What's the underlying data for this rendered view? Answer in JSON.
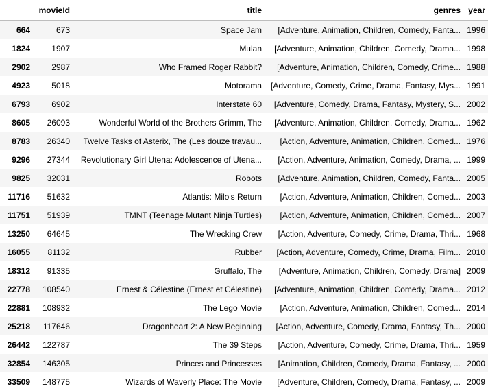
{
  "table": {
    "columns": [
      "",
      "movieId",
      "title",
      "genres",
      "year"
    ],
    "rows": [
      {
        "index": "664",
        "movieId": "673",
        "title": "Space Jam",
        "genres": "[Adventure, Animation, Children, Comedy, Fanta...",
        "year": "1996"
      },
      {
        "index": "1824",
        "movieId": "1907",
        "title": "Mulan",
        "genres": "[Adventure, Animation, Children, Comedy, Drama...",
        "year": "1998"
      },
      {
        "index": "2902",
        "movieId": "2987",
        "title": "Who Framed Roger Rabbit?",
        "genres": "[Adventure, Animation, Children, Comedy, Crime...",
        "year": "1988"
      },
      {
        "index": "4923",
        "movieId": "5018",
        "title": "Motorama",
        "genres": "[Adventure, Comedy, Crime, Drama, Fantasy, Mys...",
        "year": "1991"
      },
      {
        "index": "6793",
        "movieId": "6902",
        "title": "Interstate 60",
        "genres": "[Adventure, Comedy, Drama, Fantasy, Mystery, S...",
        "year": "2002"
      },
      {
        "index": "8605",
        "movieId": "26093",
        "title": "Wonderful World of the Brothers Grimm, The",
        "genres": "[Adventure, Animation, Children, Comedy, Drama...",
        "year": "1962"
      },
      {
        "index": "8783",
        "movieId": "26340",
        "title": "Twelve Tasks of Asterix, The (Les douze travau...",
        "genres": "[Action, Adventure, Animation, Children, Comed...",
        "year": "1976"
      },
      {
        "index": "9296",
        "movieId": "27344",
        "title": "Revolutionary Girl Utena: Adolescence of Utena...",
        "genres": "[Action, Adventure, Animation, Comedy, Drama, ...",
        "year": "1999"
      },
      {
        "index": "9825",
        "movieId": "32031",
        "title": "Robots",
        "genres": "[Adventure, Animation, Children, Comedy, Fanta...",
        "year": "2005"
      },
      {
        "index": "11716",
        "movieId": "51632",
        "title": "Atlantis: Milo's Return",
        "genres": "[Action, Adventure, Animation, Children, Comed...",
        "year": "2003"
      },
      {
        "index": "11751",
        "movieId": "51939",
        "title": "TMNT (Teenage Mutant Ninja Turtles)",
        "genres": "[Action, Adventure, Animation, Children, Comed...",
        "year": "2007"
      },
      {
        "index": "13250",
        "movieId": "64645",
        "title": "The Wrecking Crew",
        "genres": "[Action, Adventure, Comedy, Crime, Drama, Thri...",
        "year": "1968"
      },
      {
        "index": "16055",
        "movieId": "81132",
        "title": "Rubber",
        "genres": "[Action, Adventure, Comedy, Crime, Drama, Film...",
        "year": "2010"
      },
      {
        "index": "18312",
        "movieId": "91335",
        "title": "Gruffalo, The",
        "genres": "[Adventure, Animation, Children, Comedy, Drama]",
        "year": "2009"
      },
      {
        "index": "22778",
        "movieId": "108540",
        "title": "Ernest & Célestine (Ernest et Célestine)",
        "genres": "[Adventure, Animation, Children, Comedy, Drama...",
        "year": "2012"
      },
      {
        "index": "22881",
        "movieId": "108932",
        "title": "The Lego Movie",
        "genres": "[Action, Adventure, Animation, Children, Comed...",
        "year": "2014"
      },
      {
        "index": "25218",
        "movieId": "117646",
        "title": "Dragonheart 2: A New Beginning",
        "genres": "[Action, Adventure, Comedy, Drama, Fantasy, Th...",
        "year": "2000"
      },
      {
        "index": "26442",
        "movieId": "122787",
        "title": "The 39 Steps",
        "genres": "[Action, Adventure, Comedy, Crime, Drama, Thri...",
        "year": "1959"
      },
      {
        "index": "32854",
        "movieId": "146305",
        "title": "Princes and Princesses",
        "genres": "[Animation, Children, Comedy, Drama, Fantasy, ...",
        "year": "2000"
      },
      {
        "index": "33509",
        "movieId": "148775",
        "title": "Wizards of Waverly Place: The Movie",
        "genres": "[Adventure, Children, Comedy, Drama, Fantasy, ...",
        "year": "2009"
      }
    ]
  }
}
